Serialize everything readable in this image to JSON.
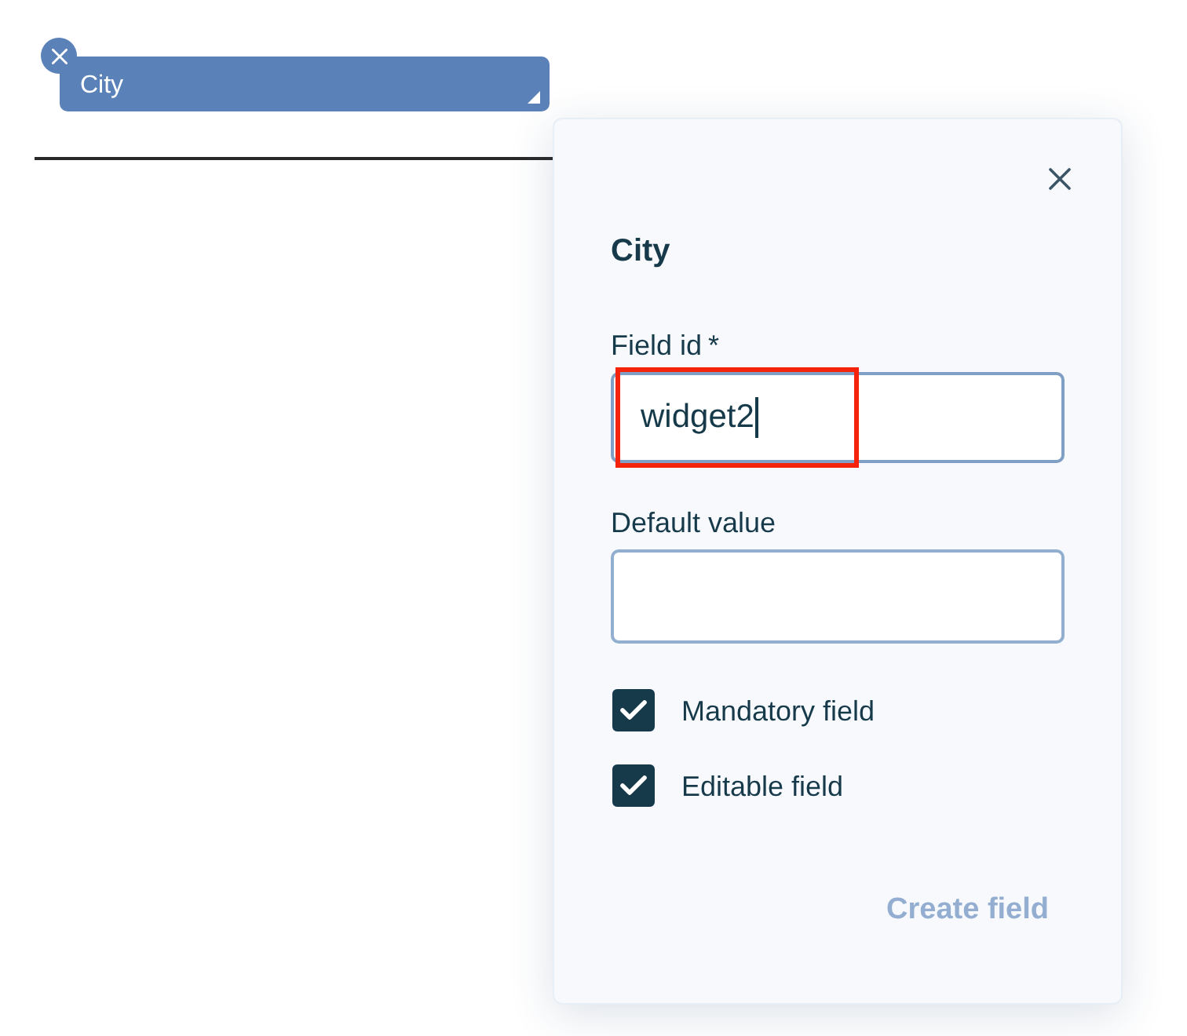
{
  "document": {
    "field_tag": {
      "label": "City"
    }
  },
  "panel": {
    "title": "City",
    "inputs": [
      {
        "label": "Field id",
        "required_mark": "*",
        "value": "widget2",
        "focused": true,
        "highlighted": true
      },
      {
        "label": "Default value",
        "focused": false,
        "highlighted": false
      }
    ],
    "checkboxes": [
      {
        "label": "Mandatory field",
        "checked": true
      },
      {
        "label": "Editable field",
        "checked": true
      }
    ],
    "button": {
      "label": "Create field",
      "disabled": true
    }
  }
}
